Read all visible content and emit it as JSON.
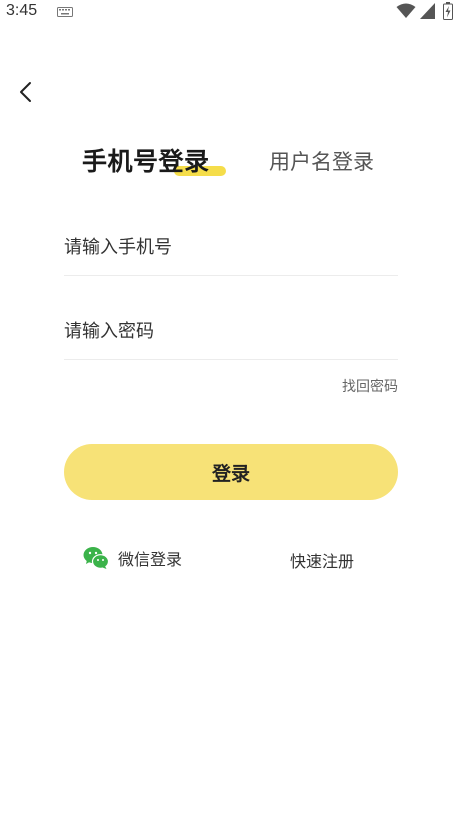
{
  "status_bar": {
    "time": "3:45",
    "icons": [
      "keyboard-icon",
      "wifi-icon",
      "signal-icon",
      "battery-icon"
    ]
  },
  "nav": {
    "back_icon": "chevron-left-icon"
  },
  "tabs": [
    {
      "label": "手机号登录",
      "active": true
    },
    {
      "label": "用户名登录",
      "active": false
    }
  ],
  "form": {
    "phone": {
      "value": "",
      "placeholder": "请输入手机号"
    },
    "password": {
      "value": "",
      "placeholder": "请输入密码"
    },
    "forgot_password": "找回密码",
    "login_label": "登录"
  },
  "footer": {
    "wechat_label": "微信登录",
    "wechat_icon": "wechat-icon",
    "register_label": "快速注册"
  },
  "colors": {
    "accent": "#f7e277",
    "tab_highlight": "#f5dd4a",
    "wechat": "#3bb34a"
  }
}
